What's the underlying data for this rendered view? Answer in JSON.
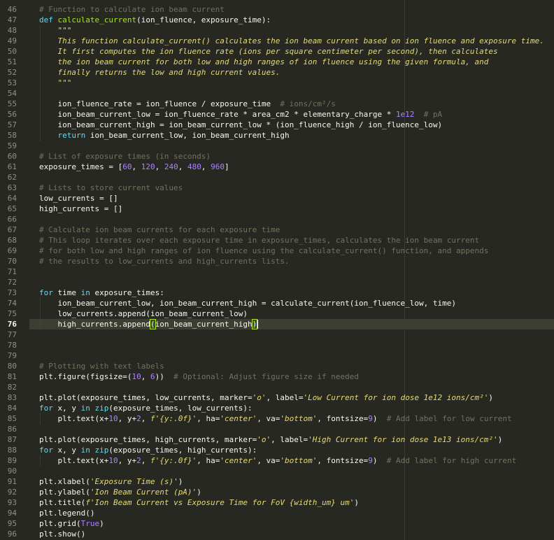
{
  "editor": {
    "active_line": "76",
    "lines": [
      {
        "n": "46",
        "tokens": [
          {
            "t": "# Function to calculate ion beam current",
            "c": "cm"
          }
        ]
      },
      {
        "n": "47",
        "tokens": [
          {
            "t": "def",
            "c": "kw"
          },
          {
            "t": " "
          },
          {
            "t": "calculate_current",
            "c": "fn"
          },
          {
            "t": "(ion_fluence, exposure_time):"
          }
        ]
      },
      {
        "n": "48",
        "tokens": [
          {
            "t": "    \"\"\"",
            "c": "ds"
          }
        ]
      },
      {
        "n": "49",
        "tokens": [
          {
            "t": "    This function calculate_current() calculates the ion beam current based on ion fluence and exposure time.",
            "c": "ds"
          }
        ]
      },
      {
        "n": "50",
        "tokens": [
          {
            "t": "    It first computes the ion fluence rate (ions per square centimeter per second), then calculates",
            "c": "ds"
          }
        ]
      },
      {
        "n": "51",
        "tokens": [
          {
            "t": "    the ion beam current for both low and high ranges of ion fluence using the given formula, and",
            "c": "ds"
          }
        ]
      },
      {
        "n": "52",
        "tokens": [
          {
            "t": "    finally returns the low and high current values.",
            "c": "ds"
          }
        ]
      },
      {
        "n": "53",
        "tokens": [
          {
            "t": "    \"\"\"",
            "c": "ds"
          }
        ]
      },
      {
        "n": "54",
        "tokens": [
          {
            "t": ""
          }
        ]
      },
      {
        "n": "55",
        "tokens": [
          {
            "t": "    ion_fluence_rate = ion_fluence / exposure_time  "
          },
          {
            "t": "# ions/cm²/s",
            "c": "cm"
          }
        ]
      },
      {
        "n": "56",
        "tokens": [
          {
            "t": "    ion_beam_current_low = ion_fluence_rate * area_cm2 * elementary_charge * "
          },
          {
            "t": "1e12",
            "c": "num"
          },
          {
            "t": "  "
          },
          {
            "t": "# pA",
            "c": "cm"
          }
        ]
      },
      {
        "n": "57",
        "tokens": [
          {
            "t": "    ion_beam_current_high = ion_beam_current_low * (ion_fluence_high / ion_fluence_low)"
          }
        ]
      },
      {
        "n": "58",
        "tokens": [
          {
            "t": "    "
          },
          {
            "t": "return",
            "c": "kw"
          },
          {
            "t": " ion_beam_current_low, ion_beam_current_high"
          }
        ]
      },
      {
        "n": "59",
        "tokens": [
          {
            "t": ""
          }
        ]
      },
      {
        "n": "60",
        "tokens": [
          {
            "t": "# List of exposure times (in seconds)",
            "c": "cm"
          }
        ]
      },
      {
        "n": "61",
        "tokens": [
          {
            "t": "exposure_times = ["
          },
          {
            "t": "60",
            "c": "num"
          },
          {
            "t": ", "
          },
          {
            "t": "120",
            "c": "num"
          },
          {
            "t": ", "
          },
          {
            "t": "240",
            "c": "num"
          },
          {
            "t": ", "
          },
          {
            "t": "480",
            "c": "num"
          },
          {
            "t": ", "
          },
          {
            "t": "960",
            "c": "num"
          },
          {
            "t": "]"
          }
        ]
      },
      {
        "n": "62",
        "tokens": [
          {
            "t": ""
          }
        ]
      },
      {
        "n": "63",
        "tokens": [
          {
            "t": "# Lists to store current values",
            "c": "cm"
          }
        ]
      },
      {
        "n": "64",
        "tokens": [
          {
            "t": "low_currents = []"
          }
        ]
      },
      {
        "n": "65",
        "tokens": [
          {
            "t": "high_currents = []"
          }
        ]
      },
      {
        "n": "66",
        "tokens": [
          {
            "t": ""
          }
        ]
      },
      {
        "n": "67",
        "tokens": [
          {
            "t": "# Calculate ion beam currents for each exposure time",
            "c": "cm"
          }
        ]
      },
      {
        "n": "68",
        "tokens": [
          {
            "t": "# This loop iterates over each exposure time in exposure_times, calculates the ion beam current",
            "c": "cm"
          }
        ]
      },
      {
        "n": "69",
        "tokens": [
          {
            "t": "# for both low and high ranges of ion fluence using the calculate_current() function, and appends",
            "c": "cm"
          }
        ]
      },
      {
        "n": "70",
        "tokens": [
          {
            "t": "# the results to low_currents and high_currents lists.",
            "c": "cm"
          }
        ]
      },
      {
        "n": "71",
        "tokens": [
          {
            "t": ""
          }
        ]
      },
      {
        "n": "72",
        "tokens": [
          {
            "t": ""
          }
        ]
      },
      {
        "n": "73",
        "tokens": [
          {
            "t": "for",
            "c": "kw"
          },
          {
            "t": " time "
          },
          {
            "t": "in",
            "c": "kw"
          },
          {
            "t": " exposure_times:"
          }
        ]
      },
      {
        "n": "74",
        "tokens": [
          {
            "t": "    ion_beam_current_low, ion_beam_current_high = calculate_current(ion_fluence_low, time)"
          }
        ]
      },
      {
        "n": "75",
        "tokens": [
          {
            "t": "    low_currents.append(ion_beam_current_low)"
          }
        ]
      },
      {
        "n": "76",
        "tokens": [
          {
            "t": "    high_currents.append"
          },
          {
            "t": "(",
            "c": "br"
          },
          {
            "t": "ion_beam_current_high"
          },
          {
            "t": ")",
            "c": "br"
          }
        ]
      },
      {
        "n": "77",
        "tokens": [
          {
            "t": ""
          }
        ]
      },
      {
        "n": "78",
        "tokens": [
          {
            "t": ""
          }
        ]
      },
      {
        "n": "79",
        "tokens": [
          {
            "t": ""
          }
        ]
      },
      {
        "n": "80",
        "tokens": [
          {
            "t": "# Plotting with text labels",
            "c": "cm"
          }
        ]
      },
      {
        "n": "81",
        "tokens": [
          {
            "t": "plt.figure(figsize=("
          },
          {
            "t": "10",
            "c": "num"
          },
          {
            "t": ", "
          },
          {
            "t": "6",
            "c": "num"
          },
          {
            "t": "))  "
          },
          {
            "t": "# Optional: Adjust figure size if needed",
            "c": "cm"
          }
        ]
      },
      {
        "n": "82",
        "tokens": [
          {
            "t": ""
          }
        ]
      },
      {
        "n": "83",
        "tokens": [
          {
            "t": "plt.plot(exposure_times, low_currents, marker="
          },
          {
            "t": "'o'",
            "c": "str"
          },
          {
            "t": ", label="
          },
          {
            "t": "'Low Current for ion dose 1e12 ions/cm²'",
            "c": "str"
          },
          {
            "t": ")"
          }
        ]
      },
      {
        "n": "84",
        "tokens": [
          {
            "t": "for",
            "c": "kw"
          },
          {
            "t": " x, y "
          },
          {
            "t": "in",
            "c": "kw"
          },
          {
            "t": " "
          },
          {
            "t": "zip",
            "c": "bi"
          },
          {
            "t": "(exposure_times, low_currents):"
          }
        ]
      },
      {
        "n": "85",
        "tokens": [
          {
            "t": "    plt.text(x+"
          },
          {
            "t": "10",
            "c": "num"
          },
          {
            "t": ", y+"
          },
          {
            "t": "2",
            "c": "num"
          },
          {
            "t": ", "
          },
          {
            "t": "f'{y:.0f}'",
            "c": "str"
          },
          {
            "t": ", ha="
          },
          {
            "t": "'center'",
            "c": "str"
          },
          {
            "t": ", va="
          },
          {
            "t": "'bottom'",
            "c": "str"
          },
          {
            "t": ", fontsize="
          },
          {
            "t": "9",
            "c": "num"
          },
          {
            "t": ")  "
          },
          {
            "t": "# Add label for low current",
            "c": "cm"
          }
        ]
      },
      {
        "n": "86",
        "tokens": [
          {
            "t": ""
          }
        ]
      },
      {
        "n": "87",
        "tokens": [
          {
            "t": "plt.plot(exposure_times, high_currents, marker="
          },
          {
            "t": "'o'",
            "c": "str"
          },
          {
            "t": ", label="
          },
          {
            "t": "'High Current for ion dose 1e13 ions/cm²'",
            "c": "str"
          },
          {
            "t": ")"
          }
        ]
      },
      {
        "n": "88",
        "tokens": [
          {
            "t": "for",
            "c": "kw"
          },
          {
            "t": " x, y "
          },
          {
            "t": "in",
            "c": "kw"
          },
          {
            "t": " "
          },
          {
            "t": "zip",
            "c": "bi"
          },
          {
            "t": "(exposure_times, high_currents):"
          }
        ]
      },
      {
        "n": "89",
        "tokens": [
          {
            "t": "    plt.text(x+"
          },
          {
            "t": "10",
            "c": "num"
          },
          {
            "t": ", y+"
          },
          {
            "t": "2",
            "c": "num"
          },
          {
            "t": ", "
          },
          {
            "t": "f'{y:.0f}'",
            "c": "str"
          },
          {
            "t": ", ha="
          },
          {
            "t": "'center'",
            "c": "str"
          },
          {
            "t": ", va="
          },
          {
            "t": "'bottom'",
            "c": "str"
          },
          {
            "t": ", fontsize="
          },
          {
            "t": "9",
            "c": "num"
          },
          {
            "t": ")  "
          },
          {
            "t": "# Add label for high current",
            "c": "cm"
          }
        ]
      },
      {
        "n": "90",
        "tokens": [
          {
            "t": ""
          }
        ]
      },
      {
        "n": "91",
        "tokens": [
          {
            "t": "plt.xlabel("
          },
          {
            "t": "'Exposure Time (s)'",
            "c": "str"
          },
          {
            "t": ")"
          }
        ]
      },
      {
        "n": "92",
        "tokens": [
          {
            "t": "plt.ylabel("
          },
          {
            "t": "'Ion Beam Current (pA)'",
            "c": "str"
          },
          {
            "t": ")"
          }
        ]
      },
      {
        "n": "93",
        "tokens": [
          {
            "t": "plt.title("
          },
          {
            "t": "f'Ion Beam Current vs Exposure Time for FoV {width_um} um'",
            "c": "str"
          },
          {
            "t": ")"
          }
        ]
      },
      {
        "n": "94",
        "tokens": [
          {
            "t": "plt.legend()"
          }
        ]
      },
      {
        "n": "95",
        "tokens": [
          {
            "t": "plt.grid("
          },
          {
            "t": "True",
            "c": "num"
          },
          {
            "t": ")"
          }
        ]
      },
      {
        "n": "96",
        "tokens": [
          {
            "t": "plt.show()"
          }
        ]
      }
    ]
  },
  "colors": {
    "background": "#272822",
    "text": "#f8f8f2",
    "comment": "#75715e",
    "keyword": "#66d9ef",
    "function": "#a6e22e",
    "string": "#e6db74",
    "number": "#ae81ff",
    "builtin": "#66d9ef",
    "bracket": "#a6e22e"
  }
}
